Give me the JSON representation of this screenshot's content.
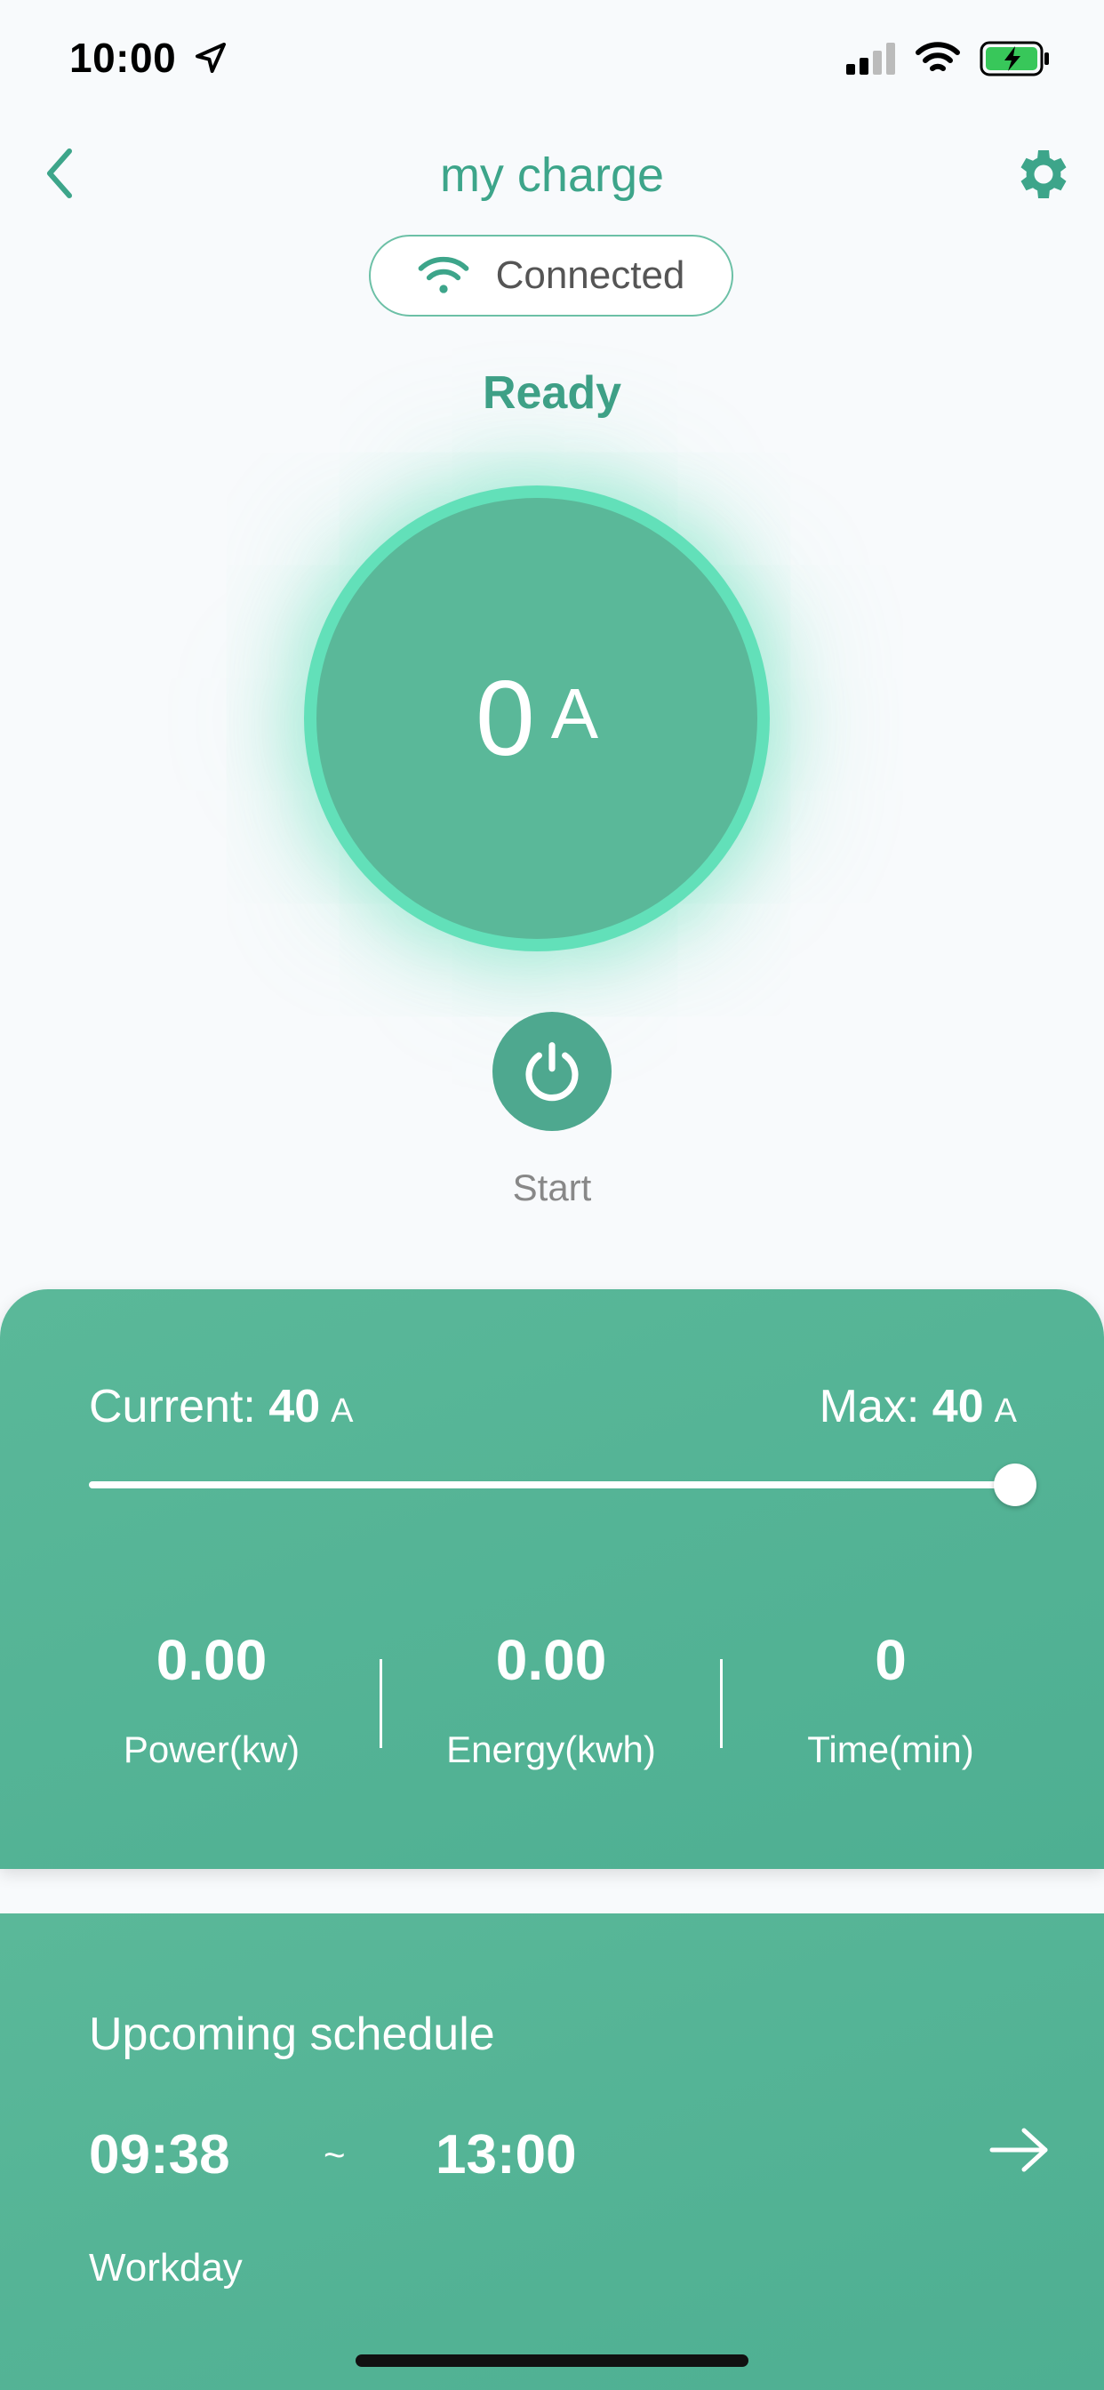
{
  "status_bar": {
    "time": "10:00",
    "icons": [
      "location-arrow-icon",
      "cellular-signal-icon",
      "wifi-icon",
      "battery-charging-icon"
    ]
  },
  "header": {
    "title": "my charge",
    "back_icon": "chevron-left-icon",
    "settings_icon": "gear-icon"
  },
  "connection": {
    "icon": "wifi-icon",
    "label": "Connected"
  },
  "charger": {
    "state": "Ready",
    "current_value": "0",
    "current_unit": "A",
    "power_button_icon": "power-icon",
    "action_label": "Start"
  },
  "current_control": {
    "current_label": "Current:",
    "current_value": "40",
    "current_unit": "A",
    "max_label": "Max:",
    "max_value": "40",
    "max_unit": "A",
    "slider_fraction": 1.0
  },
  "stats": [
    {
      "value": "0.00",
      "label": "Power(kw)"
    },
    {
      "value": "0.00",
      "label": "Energy(kwh)"
    },
    {
      "value": "0",
      "label": "Time(min)"
    }
  ],
  "schedule": {
    "title": "Upcoming schedule",
    "start": "09:38",
    "separator": "~",
    "end": "13:00",
    "days": "Workday",
    "arrow_icon": "arrow-right-icon"
  },
  "colors": {
    "brand": "#3da58a",
    "card": "#55b596",
    "glow": "#62e0b9",
    "background": "#f8fafc"
  }
}
